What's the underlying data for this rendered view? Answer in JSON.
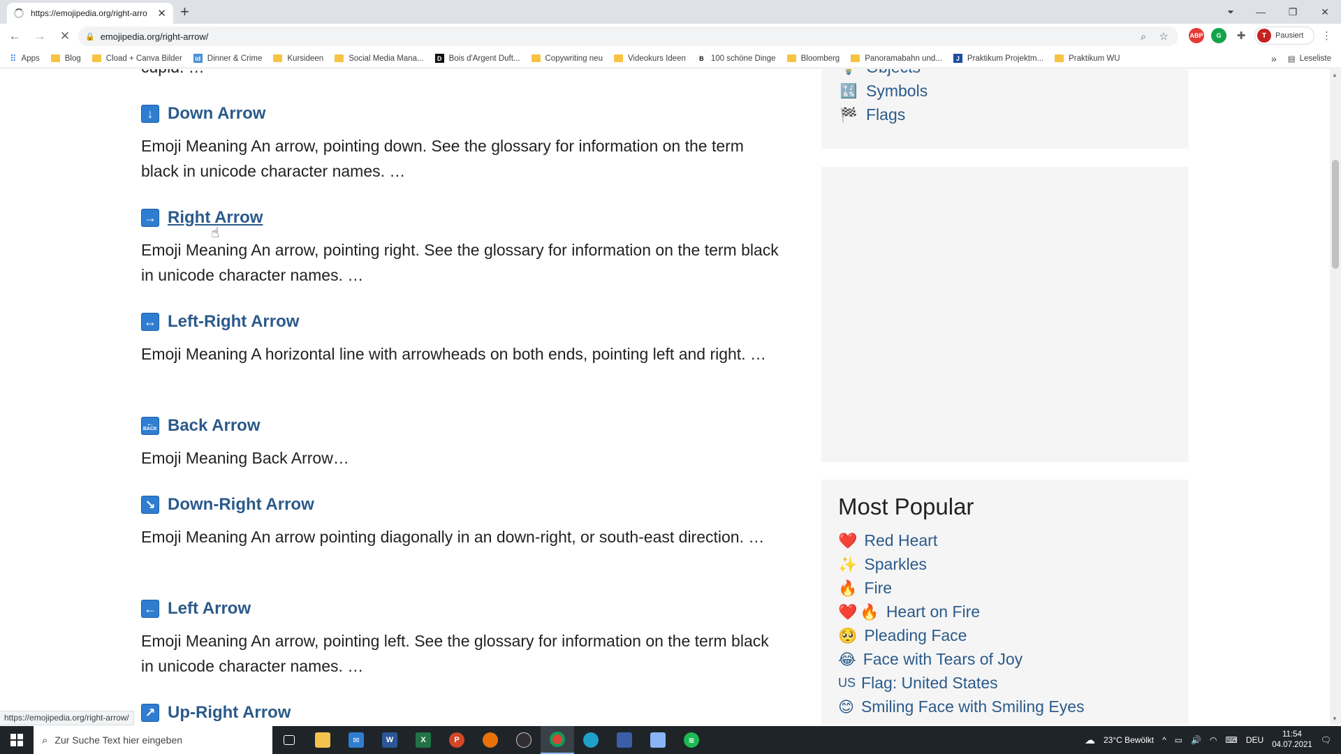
{
  "browser": {
    "tab_title": "https://emojipedia.org/right-arro",
    "tab_close": "✕",
    "new_tab": "+",
    "url": "emojipedia.org/right-arrow/",
    "profile_label": "Pausiert",
    "profile_initial": "T",
    "bookmarks": [
      {
        "label": "Apps",
        "kind": "grid"
      },
      {
        "label": "Blog",
        "kind": "folder"
      },
      {
        "label": "Cload + Canva Bilder",
        "kind": "folder"
      },
      {
        "label": "Dinner & Crime",
        "kind": "site",
        "color": "#4a90d9",
        "glyph": "id"
      },
      {
        "label": "Kursideen",
        "kind": "folder"
      },
      {
        "label": "Social Media Mana...",
        "kind": "folder"
      },
      {
        "label": "Bois d'Argent Duft...",
        "kind": "site",
        "color": "#111111",
        "glyph": "D"
      },
      {
        "label": "Copywriting neu",
        "kind": "folder"
      },
      {
        "label": "Videokurs Ideen",
        "kind": "folder"
      },
      {
        "label": "100 schöne Dinge",
        "kind": "site",
        "color": "#ffffff",
        "glyph": "B"
      },
      {
        "label": "Bloomberg",
        "kind": "folder"
      },
      {
        "label": "Panoramabahn und...",
        "kind": "folder"
      },
      {
        "label": "Praktikum Projektm...",
        "kind": "site",
        "color": "#1a4fa0",
        "glyph": "J"
      },
      {
        "label": "Praktikum WU",
        "kind": "folder"
      }
    ],
    "reading_list": "Leseliste",
    "more_bookmarks": "»",
    "status_url": "https://emojipedia.org/right-arrow/"
  },
  "results": {
    "cut_text": "cupid. …",
    "items": [
      {
        "icon": "↓",
        "title": "Down Arrow",
        "desc": "Emoji Meaning An arrow, pointing down. See the glossary for information on the term black in unicode character names. …"
      },
      {
        "icon": "→",
        "title": "Right Arrow",
        "desc": "Emoji Meaning An arrow, pointing right. See the glossary for information on the term black in unicode character names. …"
      },
      {
        "icon": "↔",
        "title": "Left-Right Arrow",
        "desc": "Emoji Meaning A horizontal line with arrowheads on both ends, pointing left and right. …"
      },
      {
        "icon": "BACK",
        "title": "Back Arrow",
        "desc": "Emoji Meaning Back Arrow…"
      },
      {
        "icon": "↘",
        "title": "Down-Right Arrow",
        "desc": "Emoji Meaning An arrow pointing diagonally in an down-right, or south-east direction. …"
      },
      {
        "icon": "←",
        "title": "Left Arrow",
        "desc": "Emoji Meaning An arrow, pointing left. See the glossary for information on the term black in unicode character names. …"
      },
      {
        "icon": "↗",
        "title": "Up-Right Arrow",
        "desc": ""
      }
    ]
  },
  "sidebar": {
    "categories": [
      {
        "icon": "💡",
        "label": "Objects"
      },
      {
        "icon": "🔣",
        "label": "Symbols"
      },
      {
        "icon": "🏁",
        "label": "Flags"
      }
    ],
    "popular_title": "Most Popular",
    "popular": [
      {
        "icon": "❤️",
        "label": "Red Heart"
      },
      {
        "icon": "✨",
        "label": "Sparkles"
      },
      {
        "icon": "🔥",
        "label": "Fire"
      },
      {
        "icon": "❤️",
        "icon2": "🔥",
        "label": "Heart on Fire"
      },
      {
        "icon": "🥺",
        "label": "Pleading Face"
      },
      {
        "icon": "😂",
        "label": "Face with Tears of Joy"
      },
      {
        "icon_text": "US",
        "label": "Flag: United States"
      },
      {
        "icon": "😊",
        "label": "Smiling Face with Smiling Eyes"
      }
    ]
  },
  "taskbar": {
    "search_placeholder": "Zur Suche Text hier eingeben",
    "weather": "23°C  Bewölkt",
    "language": "DEU",
    "time": "11:54",
    "date": "04.07.2021"
  }
}
